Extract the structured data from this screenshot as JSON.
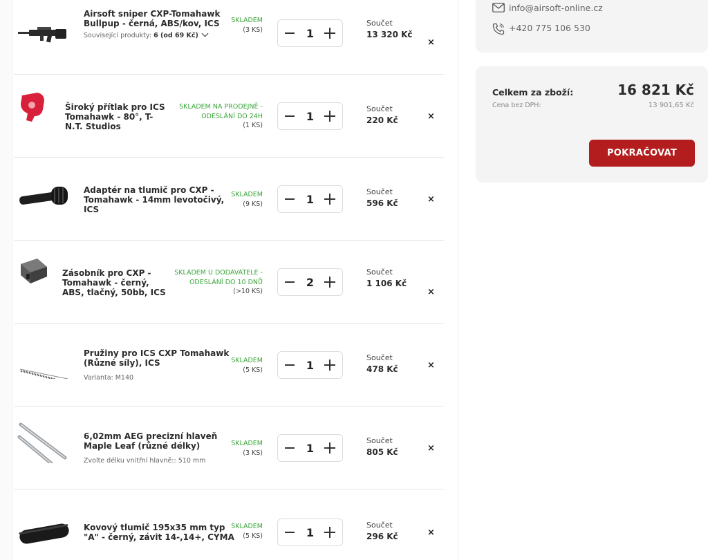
{
  "contact": {
    "email": "info@airsoft-online.cz",
    "phone": "+420 775 106 530"
  },
  "summary": {
    "total_label": "Celkem za zboží:",
    "total": "16 821 Kč",
    "net_label": "Cena bez DPH:",
    "net": "13 901,65 Kč",
    "continue_label": "POKRAČOVAT",
    "accent_color": "#b41d1d"
  },
  "cart": {
    "sum_label": "Součet",
    "remove_label": "×",
    "items": [
      {
        "name_lines": [
          "Airsoft sniper CXP-Tomahawk",
          "Bullpup - černá, ABS/kov, ICS"
        ],
        "related_prefix": "Související produkty:",
        "related_value": "6 (od 69 Kč)",
        "stock_lines": [
          "SKLADEM"
        ],
        "stock_qty": "(3 KS)",
        "quantity": "1",
        "sum": "13 320 Kč",
        "thumb_icon": "rifle-icon"
      },
      {
        "name_lines": [
          "Široký přítlak pro ICS",
          "Tomahawk - 80°, T-",
          "N.T. Studios"
        ],
        "stock_lines": [
          "SKLADEM NA PRODEJNĚ -",
          "ODESLÁNÍ DO 24H"
        ],
        "stock_qty": "(1 KS)",
        "quantity": "1",
        "sum": "220 Kč",
        "thumb_icon": "hop-up-part-icon"
      },
      {
        "name_lines": [
          "Adaptér na tlumič pro CXP -",
          "Tomahawk - 14mm levotočivý,",
          "ICS"
        ],
        "stock_lines": [
          "SKLADEM"
        ],
        "stock_qty": "(9 KS)",
        "quantity": "1",
        "sum": "596 Kč",
        "thumb_icon": "adapter-icon"
      },
      {
        "name_lines": [
          "Zásobník pro CXP -",
          "Tomahawk - černý,",
          "ABS, tlačný, 50bb, ICS"
        ],
        "stock_lines": [
          "SKLADEM U DODAVATELE -",
          "ODESLÁNÍ DO 10 DNŮ"
        ],
        "stock_qty": "(>10 KS)",
        "quantity": "2",
        "sum": "1 106 Kč",
        "thumb_icon": "magazine-icon"
      },
      {
        "name_lines": [
          "Pružiny pro ICS CXP Tomahawk",
          "(Různé síly), ICS"
        ],
        "variant": "Varianta: M140",
        "stock_lines": [
          "SKLADEM"
        ],
        "stock_qty": "(5 KS)",
        "quantity": "1",
        "sum": "478 Kč",
        "thumb_icon": "spring-icon"
      },
      {
        "name_lines": [
          "6,02mm AEG precizní hlaveň",
          "Maple Leaf (různé délky)"
        ],
        "variant": "Zvolte délku vnitřní hlavně:: 510 mm",
        "stock_lines": [
          "SKLADEM"
        ],
        "stock_qty": "(3 KS)",
        "quantity": "1",
        "sum": "805 Kč",
        "thumb_icon": "barrel-icon"
      },
      {
        "name_lines": [
          "Kovový tlumič 195x35 mm typ",
          "\"A\" - černý, závit 14-,14+, CYMA"
        ],
        "stock_lines": [
          "SKLADEM"
        ],
        "stock_qty": "(5 KS)",
        "quantity": "1",
        "sum": "296 Kč",
        "thumb_icon": "suppressor-icon"
      }
    ]
  }
}
